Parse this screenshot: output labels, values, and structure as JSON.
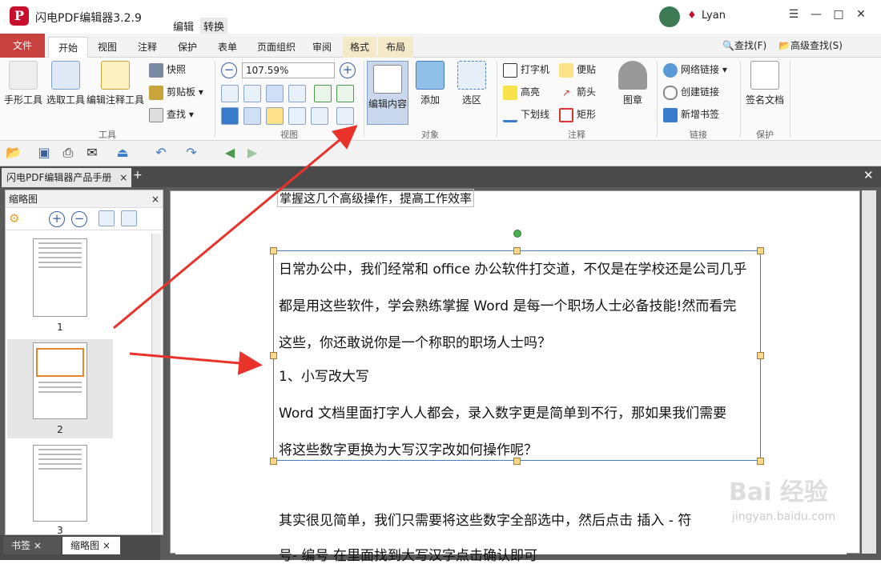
{
  "app": {
    "title": "闪电PDF编辑器3.2.9",
    "logo": "P",
    "menu": [
      "编辑",
      "转换"
    ],
    "user": "Lyan"
  },
  "window": {
    "menu_icon": "☰",
    "minimize": "—",
    "maximize": "□",
    "close": "✕"
  },
  "tabs": [
    "文件",
    "开始",
    "视图",
    "注释",
    "保护",
    "表单",
    "页面组织",
    "审阅",
    "格式",
    "布局"
  ],
  "search": {
    "find": "查找(F)",
    "advanced": "高级查找(S)"
  },
  "ribbon": {
    "tools": {
      "hand": "手形工具",
      "select": "选取工具",
      "edit_annot": "编辑注释工具",
      "snapshot": "快照",
      "clipboard": "剪贴板",
      "find": "查找",
      "label": "工具"
    },
    "view": {
      "zoom": "107.59%",
      "label": "视图"
    },
    "object": {
      "edit_content": "编辑内容",
      "add": "添加",
      "select_area": "选区",
      "label": "对象"
    },
    "annot": {
      "typewriter": "打字机",
      "note": "便贴",
      "highlight": "高亮",
      "arrow": "箭头",
      "underline": "下划线",
      "rect": "矩形",
      "stamp": "图章",
      "label": "注释"
    },
    "link": {
      "web": "网络链接",
      "create": "创建链接",
      "bookmark": "新增书签",
      "label": "链接"
    },
    "protect": {
      "sign": "签名文档",
      "label": "保护"
    }
  },
  "doc_tab": "闪电PDF编辑器产品手册",
  "panel": {
    "title": "缩略图",
    "bookmark_tab": "书签",
    "thumb_tab": "缩略图",
    "pages": [
      "1",
      "2",
      "3"
    ]
  },
  "doc": {
    "heading": "掌握这几个高级操作，提高工作效率",
    "lines": [
      "日常办公中，我们经常和  office  办公软件打交道，不仅是在学校还是公司几乎",
      "都是用这些软件，学会熟练掌握 Word 是每一个职场人士必备技能!然而看完",
      "这些，你还敢说你是一个称职的职场人士吗？",
      "1、小写改大写",
      "Word 文档里面打字人人都会，录入数字更是简单到不行，那如果我们需要",
      "将这些数字更换为大写汉字改如何操作呢？"
    ],
    "after": [
      "其实很见简单，我们只需要将这些数字全部选中，然后点击 插入 - 符",
      "号- 编号 在里面找到大写汉字点击确认即可"
    ]
  },
  "watermark": {
    "main": "Bai 经验",
    "sub": "jingyan.baidu.com"
  },
  "colors": {
    "file_tab": "#c8413f",
    "arrow": "#e8322a",
    "selection": "#4a7cc0"
  }
}
